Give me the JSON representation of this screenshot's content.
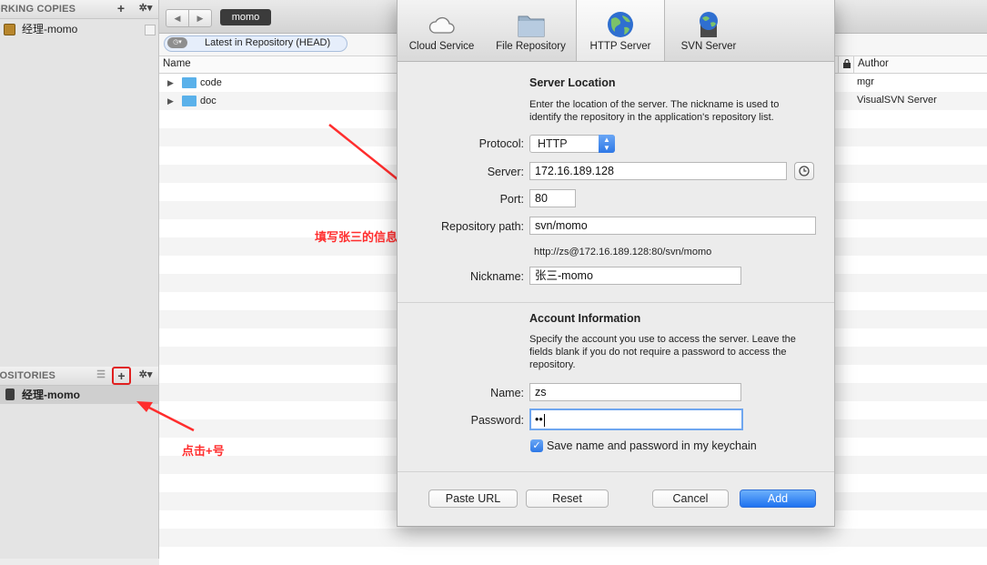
{
  "sidebar": {
    "working_copies": {
      "header": "ORKING COPIES",
      "add_label": "+",
      "gear_label": "✲▾",
      "items": [
        {
          "label": "经理-momo"
        }
      ]
    },
    "repositories": {
      "header": "POSITORIES",
      "list_label": "☰",
      "add_label": "+",
      "gear_label": "✲▾",
      "items": [
        {
          "label": "经理-momo"
        }
      ]
    }
  },
  "toolbar": {
    "back_label": "◀",
    "forward_label": "▶",
    "breadcrumb": "momo"
  },
  "filter": {
    "revision_label": "Latest in Repository (HEAD)"
  },
  "file_list": {
    "columns": {
      "name": "Name",
      "author": "Author"
    },
    "rows": [
      {
        "name": "code",
        "author": "mgr"
      },
      {
        "name": "doc",
        "author": "VisualSVN Server"
      }
    ]
  },
  "dialog": {
    "tabs": [
      {
        "label": "Cloud Service",
        "icon": "cloud-icon"
      },
      {
        "label": "File Repository",
        "icon": "folder-icon"
      },
      {
        "label": "HTTP Server",
        "icon": "globe-icon"
      },
      {
        "label": "SVN Server",
        "icon": "server-icon"
      }
    ],
    "selected_tab": "HTTP Server",
    "server_location": {
      "heading": "Server Location",
      "description_line1": "Enter the location of the server. The nickname is used to",
      "description_line2": "identify the repository in the application's repository list.",
      "protocol_label": "Protocol:",
      "protocol_value": "HTTP",
      "server_label": "Server:",
      "server_value": "172.16.189.128",
      "port_label": "Port:",
      "port_value": "80",
      "path_label": "Repository path:",
      "path_value": "svn/momo",
      "url_preview": "http://zs@172.16.189.128:80/svn/momo",
      "nickname_label": "Nickname:",
      "nickname_value": "张三-momo"
    },
    "account": {
      "heading": "Account Information",
      "description_line1": "Specify the account you use to access the server. Leave the",
      "description_line2": "fields blank if you do not require a password to access the",
      "description_line3": "repository.",
      "name_label": "Name:",
      "name_value": "zs",
      "password_label": "Password:",
      "password_value": "••",
      "keychain_label": "Save name and password in my keychain",
      "keychain_checked": true
    },
    "buttons": {
      "paste_url": "Paste URL",
      "reset": "Reset",
      "cancel": "Cancel",
      "add": "Add"
    }
  },
  "annotations": {
    "fill_info": "填写张三的信息",
    "click_plus": "点击+号"
  },
  "colors": {
    "accent": "#1f72f0",
    "annotation": "#ff2d2d",
    "folder": "#5ab1ea"
  }
}
